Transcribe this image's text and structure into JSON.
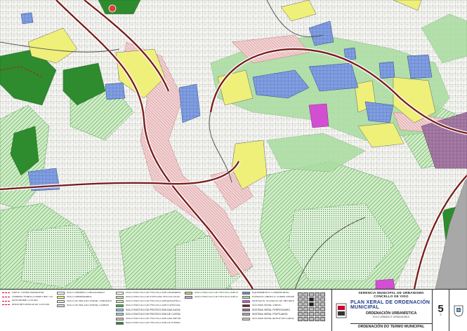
{
  "colors": {
    "urban": "#ffffff",
    "urban_dense": "#e6e6e6",
    "blue_zone": "#6f8fd6",
    "yellow_zone": "#eef07a",
    "green_dark": "#2e8b2e",
    "green_light": "#a9dca0",
    "green_hatch": "#4aa84a",
    "pink_corridor": "#e9b5b8",
    "road_dark": "#7a1f1f",
    "magenta_zone": "#d24fd2",
    "purple_zone": "#9b6a9b",
    "grey_zone": "#a8a8a8"
  },
  "legend": {
    "col1": [
      {
        "label": "LIMITE TERMO MUNICIPAL",
        "swatch": "line"
      },
      {
        "label": "DOMINIO PUBLICO MARITIMO TERRESTRE (DPMT)",
        "swatch": "line"
      },
      {
        "label": "SERVIDUME COSTAS",
        "swatch": "line"
      },
      {
        "label": "AREA INFLUENCIA DE COSTAS",
        "swatch": "line"
      }
    ],
    "col2": [
      {
        "label": "SOLO URBANO CONSOLIDADO",
        "swatch": "#ffffff"
      },
      {
        "label": "SOLO URBANIZABLE",
        "swatch": "#eef07a"
      },
      {
        "label": "SOLO DE NUCLEO RURAL TRADICIONAL",
        "swatch": "#e6e6e6"
      },
      {
        "label": "SOLO DE NUCLEO RURAL COMUN",
        "swatch": "#d8d8d8"
      }
    ],
    "col3": [
      {
        "label": "SOLO RUSTICO DE PROTECCION ORDINARIA",
        "swatch": "#ffffff"
      },
      {
        "label": "SOLO RUSTICO DE ESPECIAL PROTECCION",
        "swatch": "#bfe6b5"
      },
      {
        "label": "SOLO RUSTICO DE PROTECCION AGROPECUARIA",
        "swatch": "#cfe8a0"
      },
      {
        "label": "SOLO RUSTICO DE PROTECCION FORESTAL",
        "swatch": "#4aa84a"
      },
      {
        "label": "SOLO RUSTICO DE PROTECCION DAS AUGAS",
        "swatch": "#8fc0e8"
      },
      {
        "label": "SOLO RUSTICO DE PROTECCION DE COSTAS",
        "swatch": "#9ed0c8"
      },
      {
        "label": "SOLO RUSTICO DE PROTECCION DAS INFRAESTRUCTURAS",
        "swatch": "#e9b5b8"
      },
      {
        "label": "SOLO RUSTICO DE PROTECCION DE ESPAZOS NATURAIS",
        "swatch": "#2e8b2e"
      }
    ],
    "col4": [
      {
        "label": "SOLO RUSTICO DE PROTECCION PAISAXISTICA",
        "swatch": "#b5d88a"
      },
      {
        "label": "SOLO RUSTICO DE PROTECCION DO PATRIMONIO CULTURAL",
        "swatch": "#c9a0c9"
      }
    ],
    "col5": [
      {
        "label": "EQUIPAMENTO COMUNITARIO",
        "swatch": "#6f8fd6"
      },
      {
        "label": "ESPAZOS LIBRES E ZONAS VERDES",
        "swatch": "#a9dca0"
      },
      {
        "label": "SERVIZOS TECNICOS DE INFRAESTRUCTURAS",
        "swatch": "#d24fd2"
      },
      {
        "label": "SISTEMA XERAL VIARIO",
        "swatch": "#7a1f1f"
      },
      {
        "label": "SISTEMA XERAL FERROVIARIO",
        "swatch": "#9b6a9b"
      },
      {
        "label": "SISTEMA XERAL PORTUARIO",
        "swatch": "#a8a8a8"
      },
      {
        "label": "SISTEMA XERAL AEROPORTUARIO",
        "swatch": "#cfcfcf"
      }
    ]
  },
  "title_block": {
    "org_line1": "XERENCIA MUNICIPAL DE URBANISMO",
    "org_line2": "CONCELLO DE VIGO",
    "plan_title": "PLAN XERAL DE ORDENACIÓN MUNICIPAL",
    "section_title": "ORDENACIÓN URBANÍSTICA",
    "section_sub": "SOLO URBANO E URBANIZABLE",
    "sheet_title": "ORDENACIÓN DO TERMO MUNICIPAL",
    "sheet_number": "5",
    "sheet_sub": "9"
  },
  "index_grid": {
    "rows": 6,
    "cols": 5,
    "active": [
      7,
      12
    ]
  }
}
